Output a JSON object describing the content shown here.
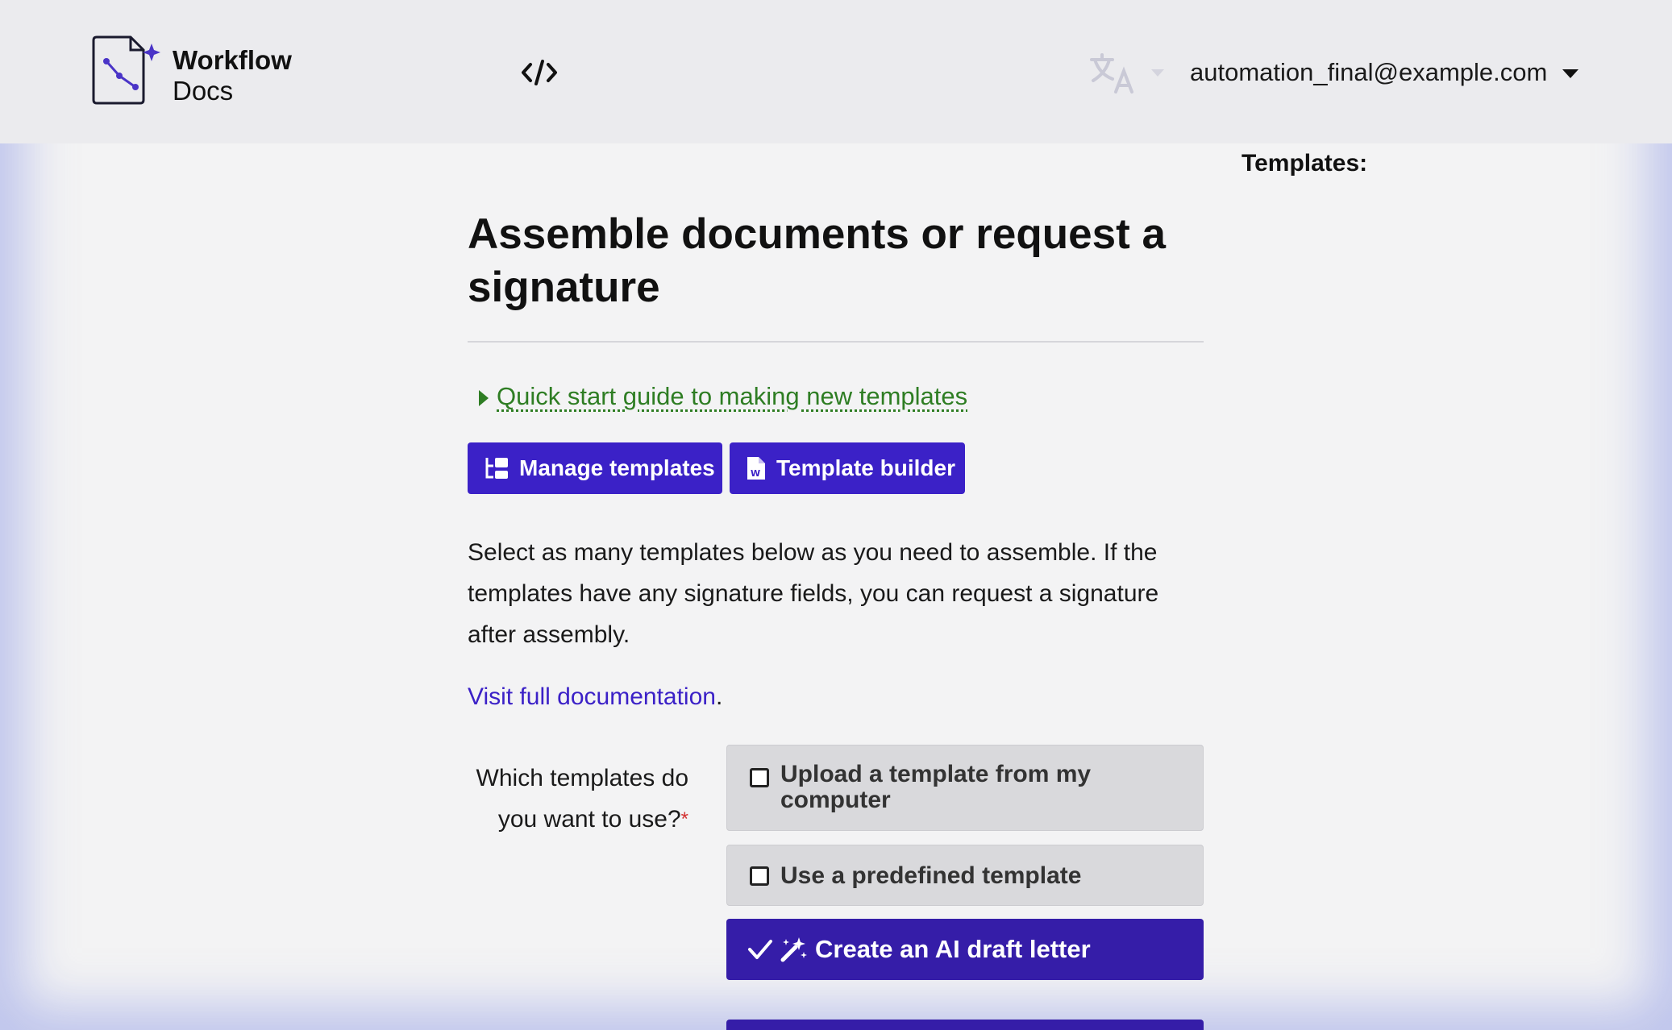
{
  "navbar": {
    "brand_line1": "Workflow",
    "brand_line2": "Docs",
    "user_email": "automation_final@example.com"
  },
  "sidebar": {
    "templates_heading": "Templates:"
  },
  "main": {
    "title": "Assemble documents or request a signature",
    "quick_start_link": "Quick start guide to making new templates",
    "manage_templates_label": "Manage templates",
    "template_builder_label": "Template builder",
    "intro_text": "Select as many templates below as you need to assemble. If the templates have any signature fields, you can request a signature after assembly.",
    "doc_link_text": "Visit full documentation",
    "doc_link_suffix": "."
  },
  "form": {
    "question_label": "Which templates do you want to use?",
    "required_mark": "*",
    "options": [
      {
        "label": "Upload a template from my computer",
        "checked": false
      },
      {
        "label": "Use a predefined template",
        "checked": false
      },
      {
        "label": "Create an AI draft letter",
        "checked": true
      }
    ]
  },
  "colors": {
    "primary": "#3b21c7",
    "selected": "#351da8",
    "link_green": "#2e7d23",
    "required_red": "#d32f2f"
  },
  "icons": {
    "logo": "document-workflow-logo-icon",
    "code": "code-icon",
    "translate": "translate-icon",
    "manage": "sitemap-icon",
    "builder": "word-file-icon",
    "ai": "magic-wand-icon",
    "check": "check-icon"
  }
}
